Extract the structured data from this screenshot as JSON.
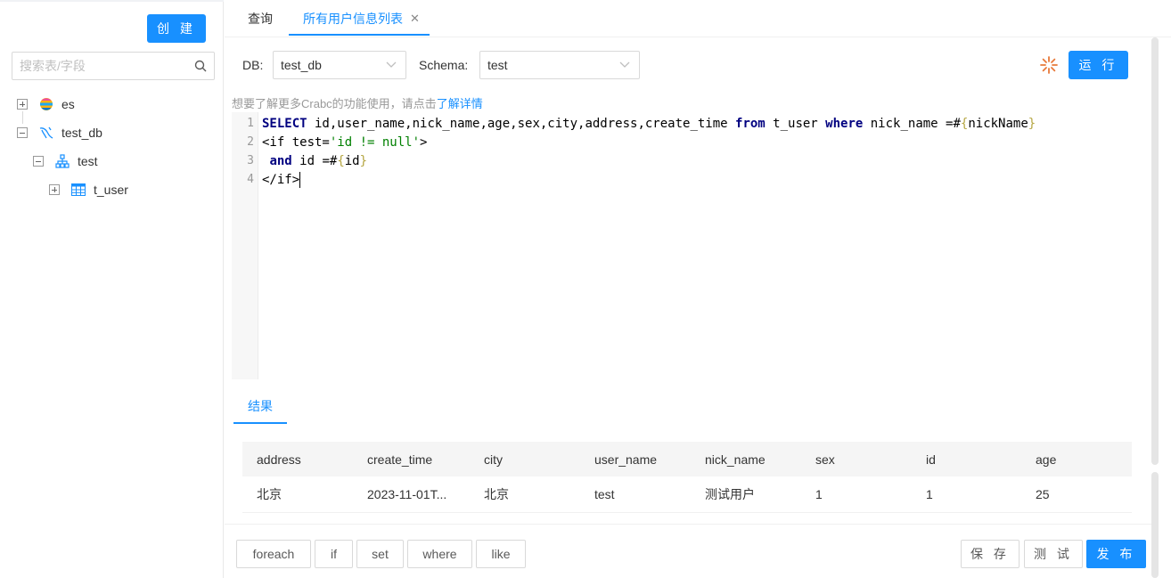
{
  "sidebar": {
    "create_label": "创 建",
    "search_placeholder": "搜索表/字段",
    "tree": {
      "es": "es",
      "test_db": "test_db",
      "schema": "test",
      "table": "t_user"
    }
  },
  "tabs": [
    {
      "label": "查询"
    },
    {
      "label": "所有用户信息列表"
    }
  ],
  "toolbar": {
    "db_label": "DB:",
    "db_value": "test_db",
    "schema_label": "Schema:",
    "schema_value": "test",
    "run_label": "运 行"
  },
  "hint": {
    "text": "想要了解更多Crabc的功能使用，请点击",
    "link": "了解详情"
  },
  "editor": {
    "line_numbers": [
      "1",
      "2",
      "3",
      "4"
    ]
  },
  "result": {
    "tab_label": "结果",
    "columns": [
      "address",
      "create_time",
      "city",
      "user_name",
      "nick_name",
      "sex",
      "id",
      "age"
    ],
    "rows": [
      [
        "北京",
        "2023-11-01T...",
        "北京",
        "test",
        "测试用户",
        "1",
        "1",
        "25"
      ]
    ]
  },
  "footer": {
    "snippets": [
      "foreach",
      "if",
      "set",
      "where",
      "like"
    ],
    "save_label": "保 存",
    "test_label": "测 试",
    "publish_label": "发 布"
  },
  "colors": {
    "primary": "#1890ff",
    "sql_keyword": "#000080",
    "sql_string": "#008000",
    "sql_brace": "#b5a642"
  }
}
